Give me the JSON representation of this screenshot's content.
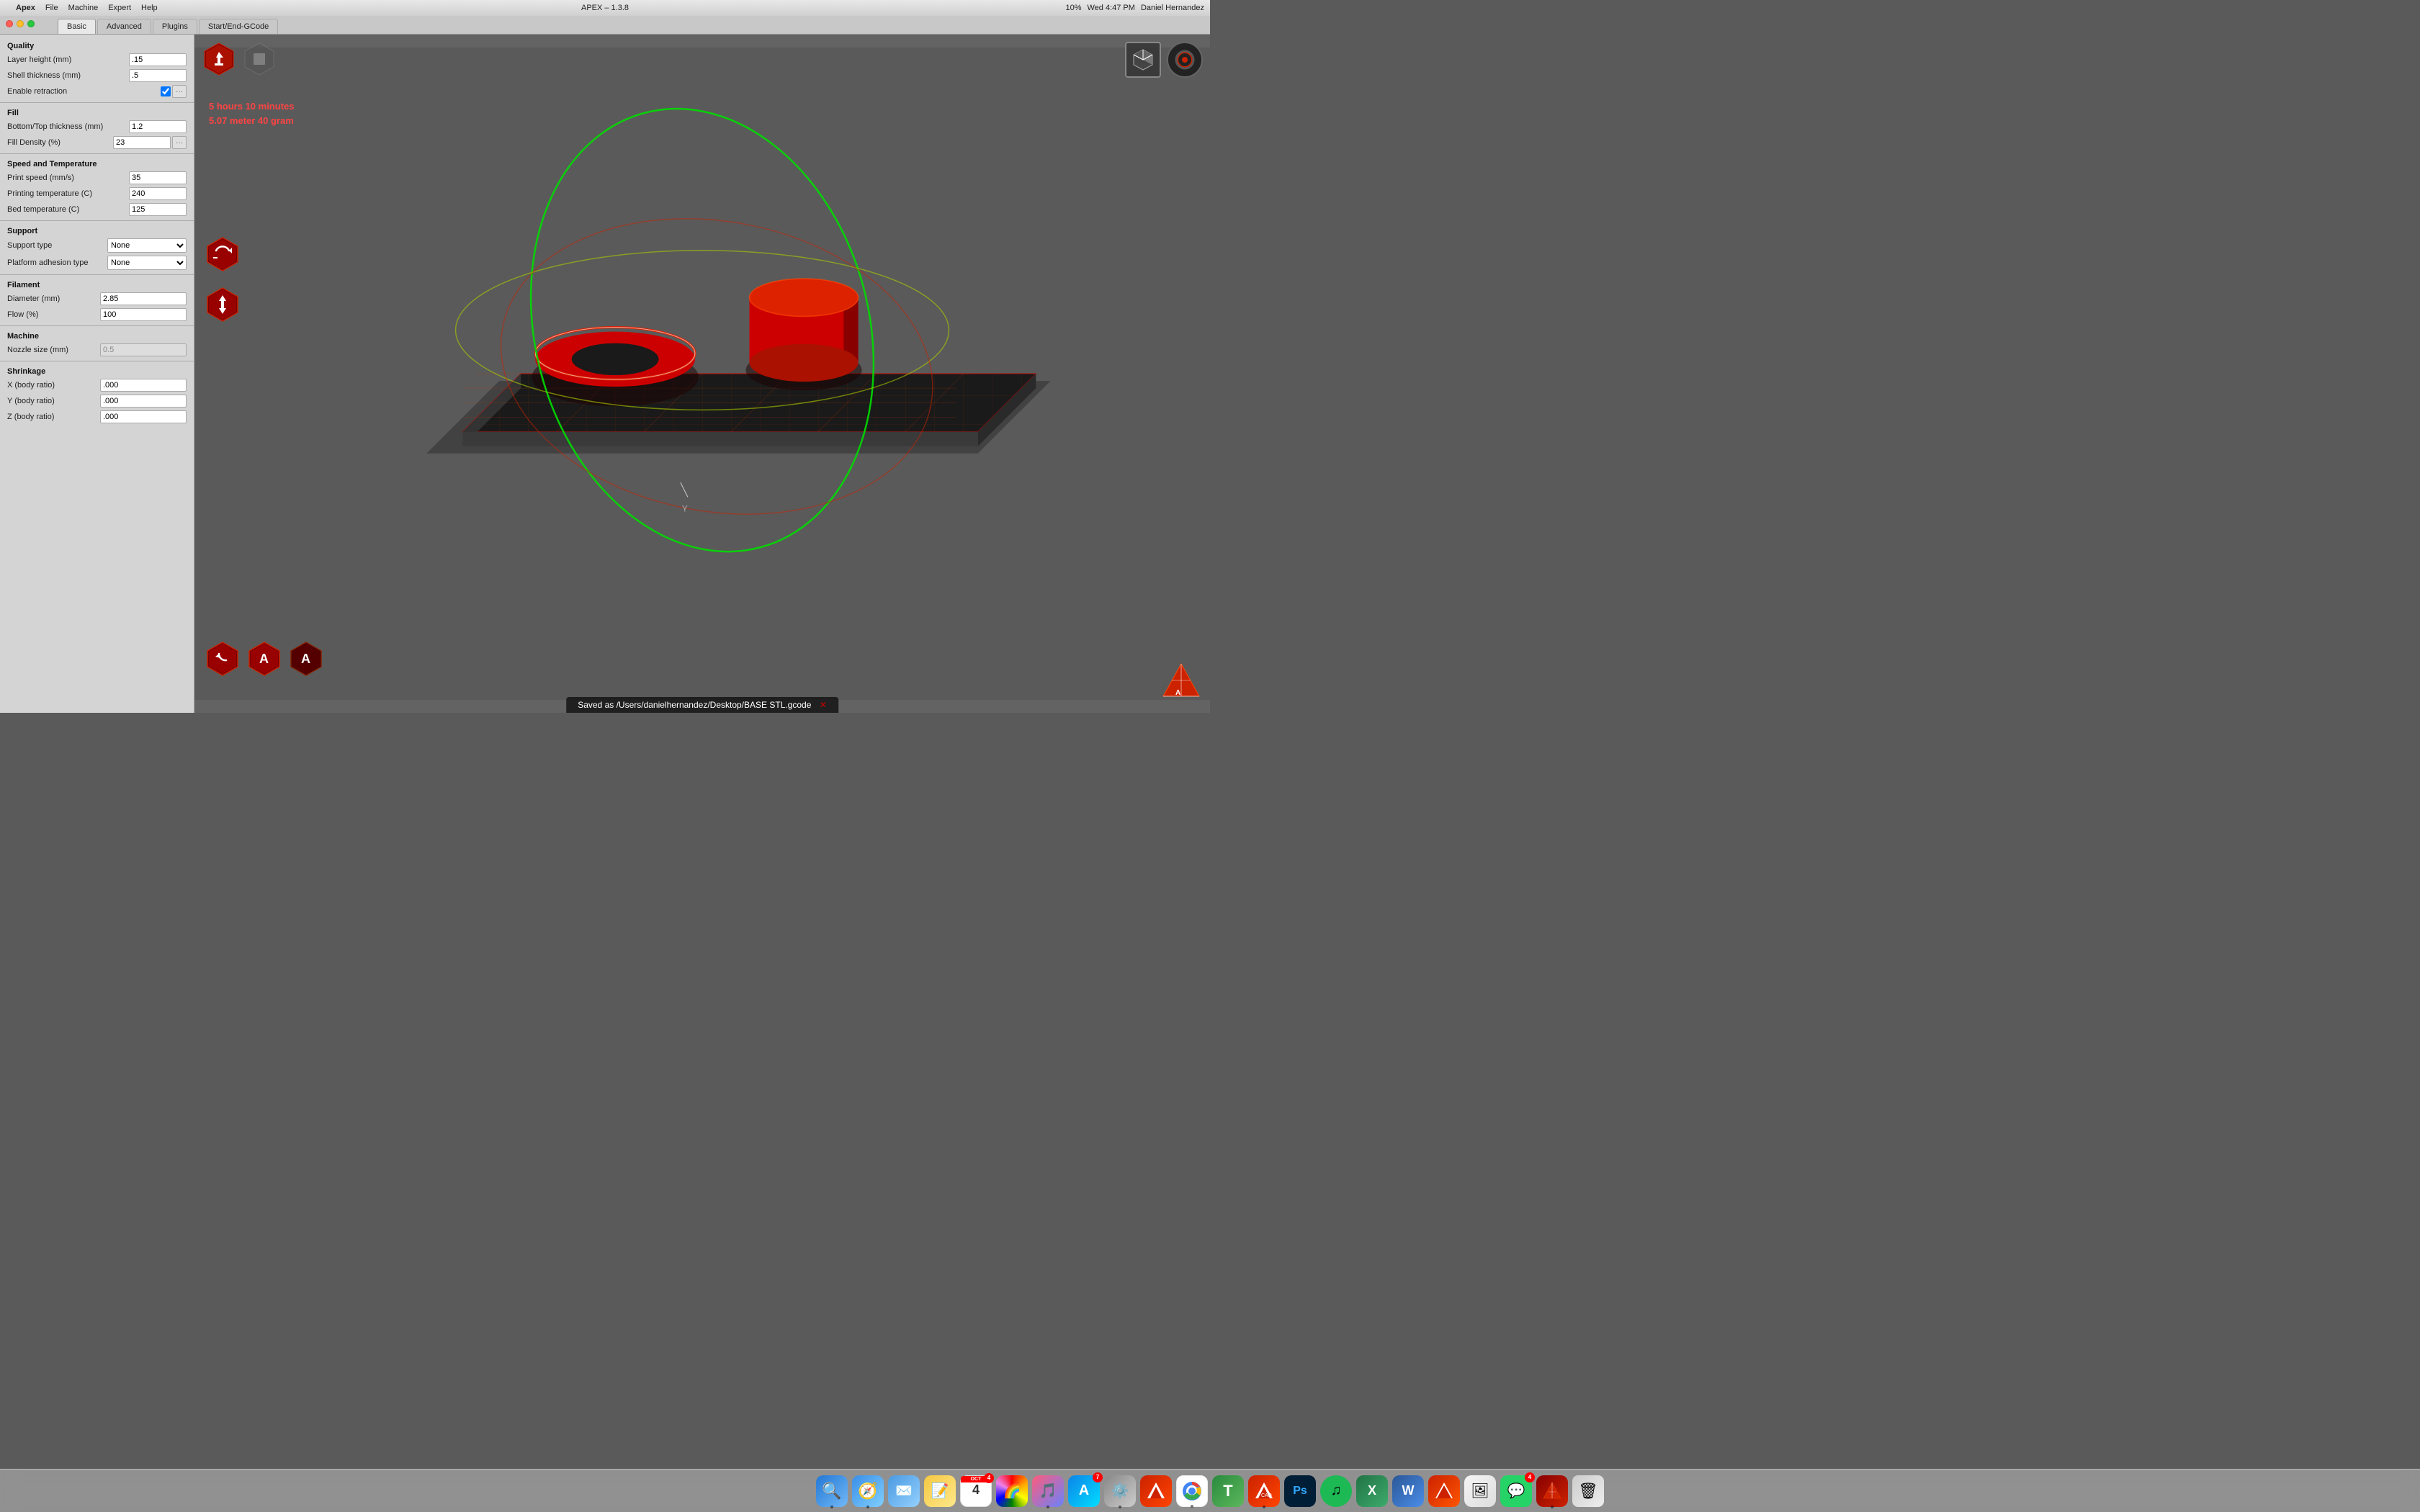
{
  "menubar": {
    "title": "APEX – 1.3.8",
    "apple": "",
    "menus": [
      "Apex",
      "File",
      "Machine",
      "Expert",
      "Help"
    ],
    "right": {
      "time": "Wed 4:47 PM",
      "user": "Daniel Hernandez",
      "battery": "10%"
    }
  },
  "tabs": [
    {
      "label": "Basic",
      "active": true
    },
    {
      "label": "Advanced",
      "active": false
    },
    {
      "label": "Plugins",
      "active": false
    },
    {
      "label": "Start/End-GCode",
      "active": false
    }
  ],
  "leftPanel": {
    "sections": {
      "quality": {
        "header": "Quality",
        "fields": [
          {
            "label": "Layer height (mm)",
            "value": ".15",
            "type": "input"
          },
          {
            "label": "Shell thickness (mm)",
            "value": ".5",
            "type": "input"
          },
          {
            "label": "Enable retraction",
            "value": true,
            "type": "checkbox"
          }
        ]
      },
      "fill": {
        "header": "Fill",
        "fields": [
          {
            "label": "Bottom/Top thickness (mm)",
            "value": "1.2",
            "type": "input"
          },
          {
            "label": "Fill Density (%)",
            "value": "23",
            "type": "input",
            "hasDots": true
          }
        ]
      },
      "speedTemp": {
        "header": "Speed and Temperature",
        "fields": [
          {
            "label": "Print speed (mm/s)",
            "value": "35",
            "type": "input"
          },
          {
            "label": "Printing temperature (C)",
            "value": "240",
            "type": "input"
          },
          {
            "label": "Bed temperature (C)",
            "value": "125",
            "type": "input"
          }
        ]
      },
      "support": {
        "header": "Support",
        "fields": [
          {
            "label": "Support type",
            "value": "None",
            "type": "select"
          },
          {
            "label": "Platform adhesion type",
            "value": "None",
            "type": "select"
          }
        ]
      },
      "filament": {
        "header": "Filament",
        "fields": [
          {
            "label": "Diameter (mm)",
            "value": "2.85",
            "type": "input"
          },
          {
            "label": "Flow (%)",
            "value": "100",
            "type": "input"
          }
        ]
      },
      "machine": {
        "header": "Machine",
        "fields": [
          {
            "label": "Nozzle size (mm)",
            "value": "0.5",
            "type": "input",
            "disabled": true
          }
        ]
      },
      "shrinkage": {
        "header": "Shrinkage",
        "fields": [
          {
            "label": "X (body ratio)",
            "value": ".000",
            "type": "input"
          },
          {
            "label": "Y (body ratio)",
            "value": ".000",
            "type": "input"
          },
          {
            "label": "Z (body ratio)",
            "value": ".000",
            "type": "input"
          }
        ]
      }
    }
  },
  "viewport": {
    "printTime": "5 hours 10 minutes",
    "printMaterial": "5.07 meter 40 gram",
    "statusBar": "Saved as /Users/danielhernandez/Desktop/BASE STL.gcode"
  },
  "dock": {
    "items": [
      {
        "name": "finder",
        "color": "#2278d4",
        "label": "Finder",
        "icon": "🔍"
      },
      {
        "name": "safari",
        "color": "#3a8ee6",
        "label": "Safari",
        "icon": "🧭"
      },
      {
        "name": "mail",
        "color": "#4a9ae1",
        "label": "Mail",
        "icon": "✉️"
      },
      {
        "name": "notes",
        "color": "#f5c842",
        "label": "Notes",
        "icon": "📝"
      },
      {
        "name": "calendar",
        "color": "#f55",
        "label": "Calendar",
        "icon": "📅",
        "badge": "4"
      },
      {
        "name": "photos",
        "color": "#e85",
        "label": "Photos",
        "icon": "🌈"
      },
      {
        "name": "itunes",
        "color": "#fc5",
        "label": "iTunes",
        "icon": "🎵"
      },
      {
        "name": "appstore",
        "color": "#2278d4",
        "label": "App Store",
        "icon": "A",
        "badge": "7"
      },
      {
        "name": "system-prefs",
        "color": "#888",
        "label": "System Prefs",
        "icon": "⚙️"
      },
      {
        "name": "autodesk",
        "color": "#cc2200",
        "label": "Autodesk",
        "icon": "△"
      },
      {
        "name": "chrome",
        "color": "#4285f4",
        "label": "Chrome",
        "icon": "◕"
      },
      {
        "name": "torchvac",
        "color": "#44aa44",
        "label": "Torchvac",
        "icon": "T"
      },
      {
        "name": "autocad",
        "color": "#cc2200",
        "label": "AutoCAD",
        "icon": "△"
      },
      {
        "name": "photoshop",
        "color": "#001e36",
        "label": "Photoshop",
        "icon": "Ps"
      },
      {
        "name": "spotify",
        "color": "#1db954",
        "label": "Spotify",
        "icon": "♫"
      },
      {
        "name": "excel",
        "color": "#217346",
        "label": "Excel",
        "icon": "X"
      },
      {
        "name": "word",
        "color": "#2b5797",
        "label": "Word",
        "icon": "W"
      },
      {
        "name": "sketchup",
        "color": "#cc2200",
        "label": "SketchUp",
        "icon": "S"
      },
      {
        "name": "preview",
        "color": "#888",
        "label": "Preview",
        "icon": "🖼"
      },
      {
        "name": "whatsapp",
        "color": "#25d366",
        "label": "WhatsApp",
        "icon": "💬",
        "badge": "4"
      },
      {
        "name": "apex",
        "color": "#cc2200",
        "label": "APEX",
        "icon": "△"
      },
      {
        "name": "trash",
        "color": "#888",
        "label": "Trash",
        "icon": "🗑"
      }
    ]
  }
}
